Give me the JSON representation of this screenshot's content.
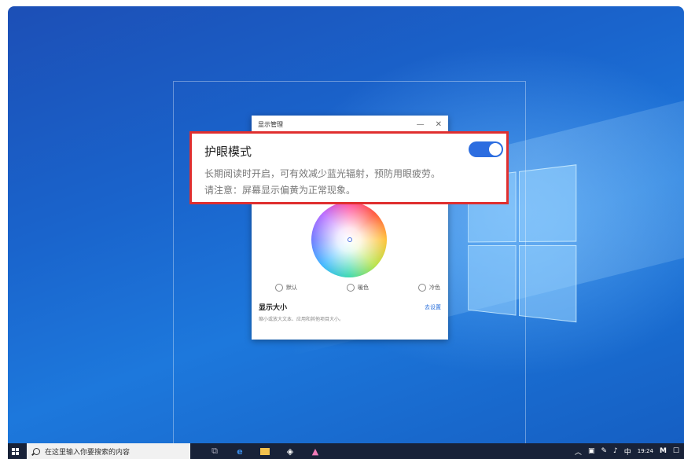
{
  "dialog": {
    "title": "显示管理",
    "minimize_glyph": "—",
    "close_glyph": "✕",
    "modes": [
      "默认",
      "暖色",
      "冷色"
    ],
    "size_title": "显示大小",
    "size_link": "去设置",
    "size_desc": "缩小或放大文本、应用和其他项目大小。"
  },
  "callout": {
    "title": "护眼模式",
    "line1": "长期阅读时开启，可有效减少蓝光辐射，预防用眼疲劳。",
    "line2": "请注意：屏幕显示偏黄为正常现象。",
    "toggle_on": true
  },
  "taskbar": {
    "search_placeholder": "在这里输入你要搜索的内容",
    "ime": "中",
    "time": "19:24"
  },
  "colors": {
    "accent": "#2c6de0",
    "highlight_border": "#e02f2f"
  }
}
